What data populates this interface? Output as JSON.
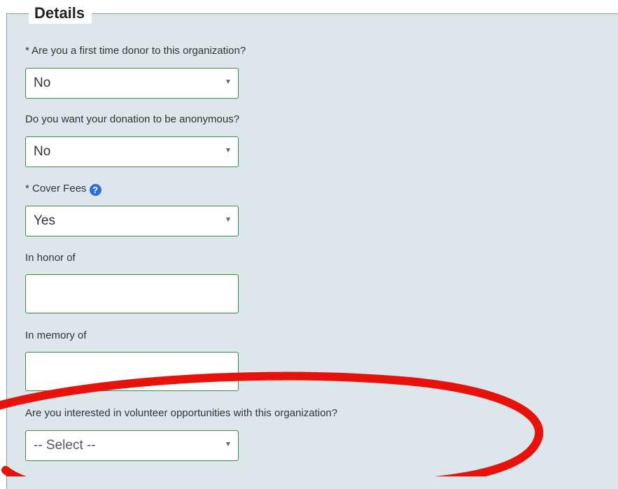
{
  "form": {
    "legend": "Details",
    "fields": {
      "first_time_donor": {
        "label": "* Are you a first time donor to this organization?",
        "value": "No"
      },
      "anonymous": {
        "label": "Do you want your donation to be anonymous?",
        "value": "No"
      },
      "cover_fees": {
        "label": "* Cover Fees",
        "help_icon": "question-circle-icon",
        "help_glyph": "?",
        "value": "Yes"
      },
      "in_honor_of": {
        "label": "In honor of",
        "value": ""
      },
      "in_memory_of": {
        "label": "In memory of",
        "value": ""
      },
      "volunteer": {
        "label": "Are you interested in volunteer opportunities with this organization?",
        "value": "-- Select --"
      }
    }
  },
  "colors": {
    "panel_background": "#dde6ea",
    "field_border": "#3c8c47",
    "help_icon": "#2f6fd4",
    "annotation_ellipse": "#e8120c"
  }
}
